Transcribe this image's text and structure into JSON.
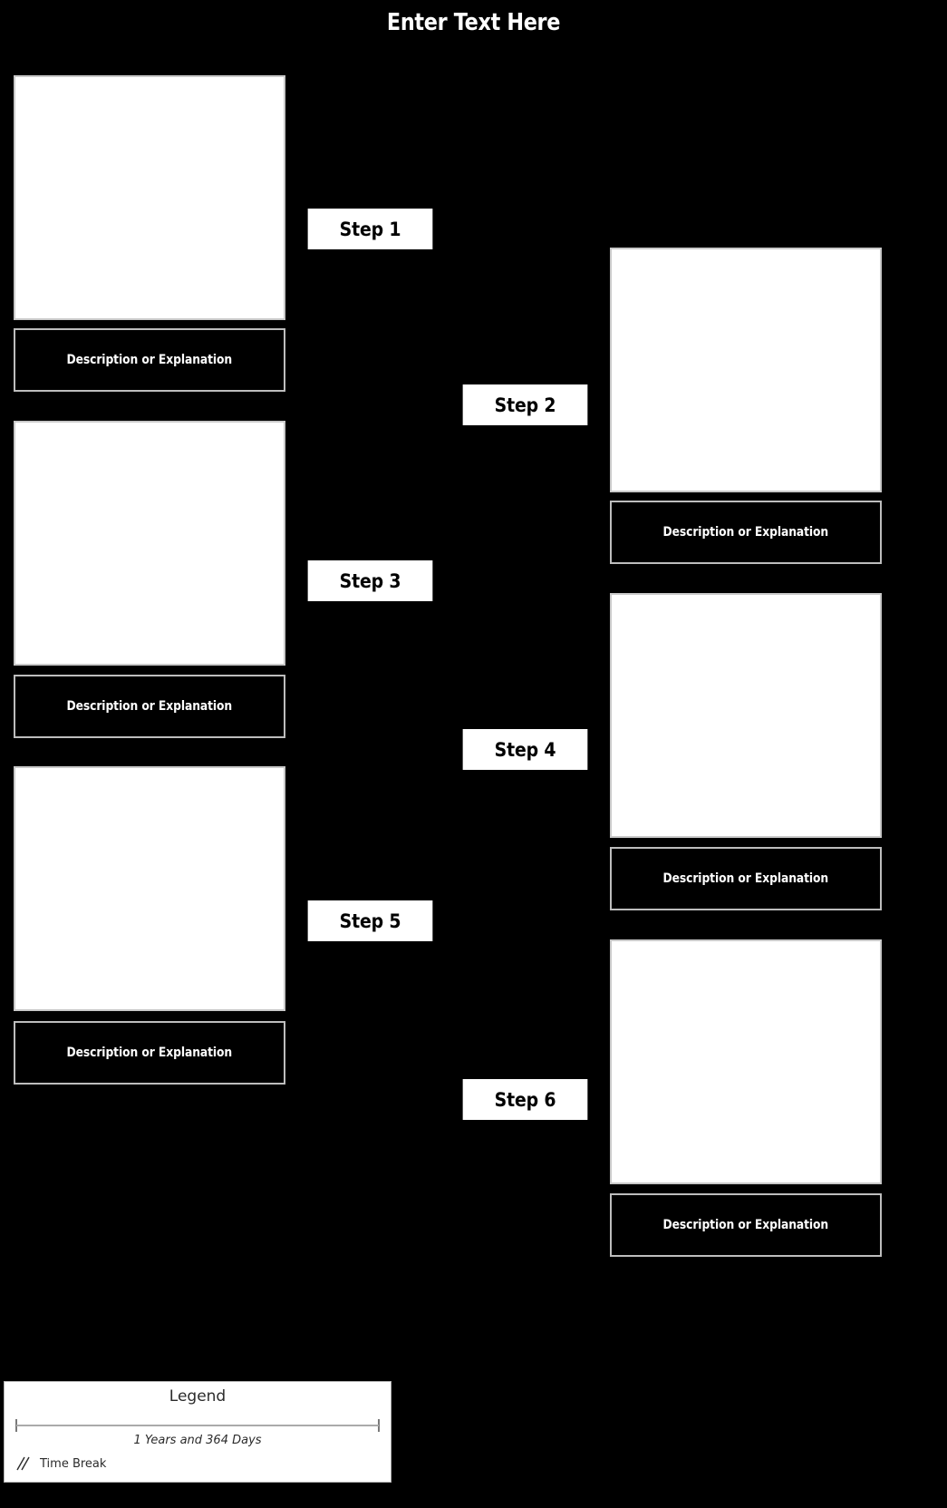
{
  "title": "Enter Text Here",
  "colors": {
    "background": "#000000",
    "placeholder_fill": "#ffffff",
    "placeholder_border": "#c9c9c9",
    "step_fill": "#ffffff",
    "step_text": "#000000",
    "description_fill": "#000000",
    "description_border": "#bdbdbd",
    "description_text": "#ffffff",
    "legend_fill": "#ffffff",
    "legend_text": "#2b2b2b"
  },
  "steps": [
    {
      "label": "Step 1",
      "description": "Description or Explanation"
    },
    {
      "label": "Step 2",
      "description": "Description or Explanation"
    },
    {
      "label": "Step 3",
      "description": "Description or Explanation"
    },
    {
      "label": "Step 4",
      "description": "Description or Explanation"
    },
    {
      "label": "Step 5",
      "description": "Description or Explanation"
    },
    {
      "label": "Step 6",
      "description": "Description or Explanation"
    }
  ],
  "legend": {
    "title": "Legend",
    "scale_caption": "1 Years and 364 Days",
    "time_break_label": "Time Break",
    "time_break_icon": "time-break-icon"
  }
}
